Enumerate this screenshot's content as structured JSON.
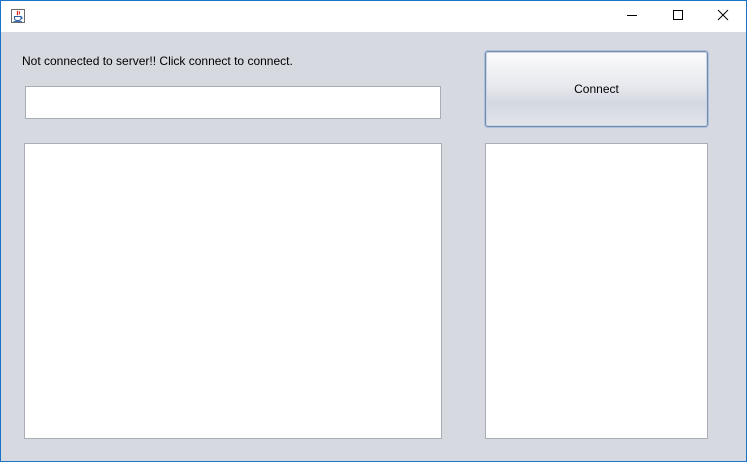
{
  "window": {
    "title": "",
    "icons": {
      "app": "java-cup-icon",
      "minimize": "minimize-icon",
      "maximize": "maximize-icon",
      "close": "close-icon"
    }
  },
  "status": {
    "text": "Not connected to server!! Click connect to connect."
  },
  "message_input": {
    "value": "",
    "placeholder": ""
  },
  "connect_button": {
    "label": "Connect"
  },
  "chat_area": {
    "lines": []
  },
  "user_list": {
    "items": []
  },
  "colors": {
    "background": "#d6d9df",
    "window_border": "#1a73c8",
    "field_border": "#a9adb5"
  }
}
